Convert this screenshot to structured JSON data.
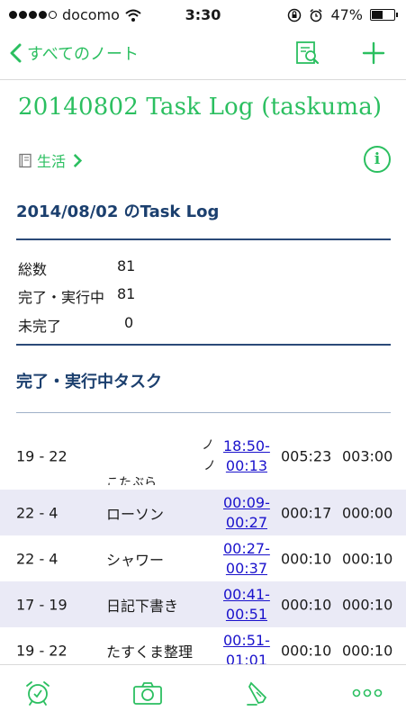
{
  "status_bar": {
    "carrier": "docomo",
    "time": "3:30",
    "battery_percent": "47%",
    "signal_bars_filled": 4,
    "battery_level": 0.47
  },
  "nav": {
    "back_label": "すべてのノート"
  },
  "note": {
    "title": "20140802 Task Log (taskuma)",
    "notebook": "生活",
    "info_label": "i"
  },
  "log_heading": "2014/08/02 のTask Log",
  "summary": [
    {
      "label": "総数",
      "value": "81"
    },
    {
      "label": "完了・実行中",
      "value": "81"
    },
    {
      "label": "未完了",
      "value": "0"
    }
  ],
  "tasks_heading": "完了・実行中タスク",
  "tasks": [
    {
      "range": "19 - 22",
      "name": "",
      "start": "18:50-",
      "end": "00:13",
      "dur1": "005:23",
      "dur2": "003:00"
    },
    {
      "range": "22 - 4",
      "name": "ローソン",
      "start": "00:09-",
      "end": "00:27",
      "dur1": "000:17",
      "dur2": "000:00"
    },
    {
      "range": "22 - 4",
      "name": "シャワー",
      "start": "00:27-",
      "end": "00:37",
      "dur1": "000:10",
      "dur2": "000:10"
    },
    {
      "range": "17 - 19",
      "name": "日記下書き",
      "start": "00:41-",
      "end": "00:51",
      "dur1": "000:10",
      "dur2": "000:10"
    },
    {
      "range": "19 - 22",
      "name": "たすくま整理",
      "start": "00:51-",
      "end": "01:01",
      "dur1": "000:10",
      "dur2": "000:10"
    }
  ],
  "colors": {
    "accent_green": "#2bbf60",
    "heading_navy": "#1b3f6e",
    "link_blue": "#1a12cc",
    "row_alt": "#eaeaf6"
  },
  "toolbar": {
    "icons": [
      "alarm-icon",
      "camera-icon",
      "pen-icon",
      "more-icon"
    ]
  }
}
